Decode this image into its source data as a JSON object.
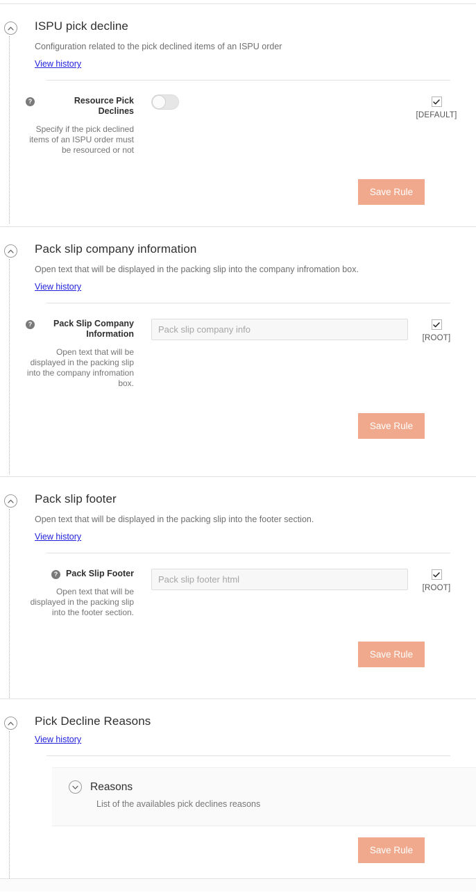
{
  "colors": {
    "accent_button": "#f0a98c",
    "link": "#2020dd",
    "text_primary": "#2f2f2f",
    "text_muted": "#757575",
    "panel_bg": "#fafafa",
    "input_bg": "#f7f7f7",
    "divider": "#e2e2e2"
  },
  "common": {
    "view_history": "View history",
    "save_rule": "Save Rule",
    "collapse_icon": "chevron-up-circle-icon",
    "expand_icon": "chevron-down-circle-icon",
    "help_icon": "question-mark-circle-icon",
    "help_glyph": "?",
    "check_glyph": "✔"
  },
  "sections": [
    {
      "id": "ispu-pick-decline",
      "title": "ISPU pick decline",
      "description": "Configuration related to the pick declined items of an ISPU order",
      "view_history": "View history",
      "field": {
        "name": "Resource Pick Declines",
        "hint": "Specify if the pick declined items of an ISPU order must be resourced or not",
        "control": "toggle",
        "toggle_state": "off",
        "scope_checked": true,
        "scope_label": "[DEFAULT]"
      },
      "save_rule": "Save Rule"
    },
    {
      "id": "pack-slip-company-information",
      "title": "Pack slip company information",
      "description": "Open text that will be displayed in the packing slip into the company infromation box.",
      "view_history": "View history",
      "field": {
        "name": "Pack Slip Company Information",
        "hint": "Open text that will be displayed in the packing slip into the company infromation box.",
        "control": "text",
        "value": "",
        "placeholder": "Pack slip company info",
        "scope_checked": true,
        "scope_label": "[ROOT]"
      },
      "save_rule": "Save Rule"
    },
    {
      "id": "pack-slip-footer",
      "title": "Pack slip footer",
      "description": "Open text that will be displayed in the packing slip into the footer section.",
      "view_history": "View history",
      "field": {
        "name": "Pack Slip Footer",
        "hint": "Open text that will be displayed in the packing slip into the footer section.",
        "control": "text",
        "value": "",
        "placeholder": "Pack slip footer html",
        "scope_checked": true,
        "scope_label": "[ROOT]"
      },
      "save_rule": "Save Rule"
    },
    {
      "id": "pick-decline-reasons",
      "title": "Pick Decline Reasons",
      "description": "",
      "view_history": "View history",
      "sub_panel": {
        "title": "Reasons",
        "description": "List of the availables pick declines reasons",
        "expanded": false
      },
      "save_rule": "Save Rule"
    }
  ]
}
